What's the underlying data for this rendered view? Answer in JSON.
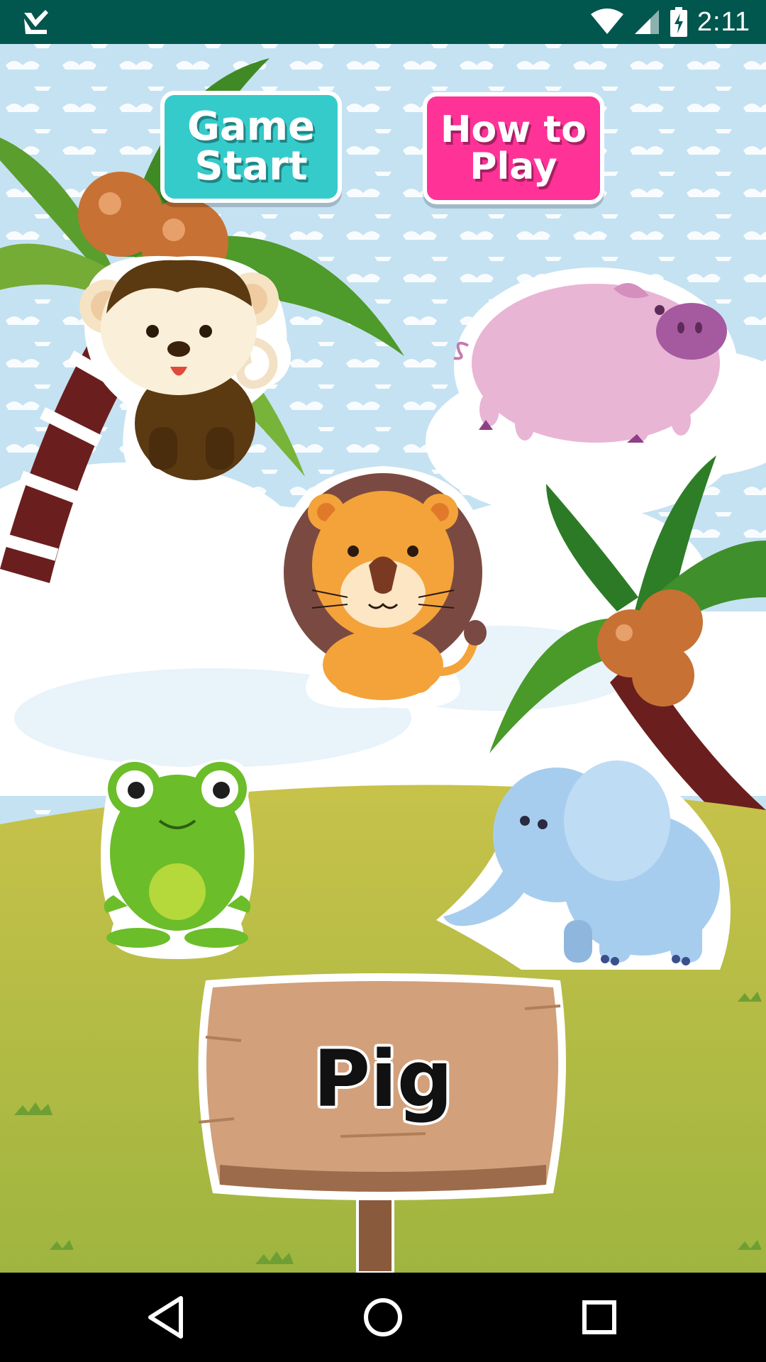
{
  "status_bar": {
    "time": "2:11",
    "icons": [
      "app-notification-icon",
      "wifi-icon",
      "cell-signal-icon",
      "battery-charging-icon"
    ]
  },
  "game": {
    "buttons": {
      "start_line1": "Game",
      "start_line2": "Start",
      "howto_line1": "How to",
      "howto_line2": "Play"
    },
    "animals": [
      "monkey",
      "pig",
      "lion",
      "frog",
      "elephant"
    ],
    "sign_word": "Pig"
  },
  "nav_bar": {
    "icons": [
      "back-icon",
      "home-icon",
      "recents-icon"
    ]
  },
  "colors": {
    "status_bar": "#01564E",
    "start_button": "#35CBCB",
    "howto_button": "#FF3297",
    "sky": "#CFE8F6",
    "grass": "#B5B43A",
    "sign": "#D2A07A"
  }
}
